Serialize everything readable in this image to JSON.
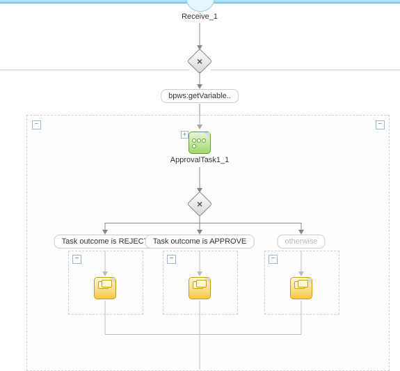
{
  "start": {
    "label": "Receive_1"
  },
  "gateway1": {
    "symbol": "×"
  },
  "condition1": {
    "label": "bpws:getVariable.."
  },
  "outerContainer": {
    "collapseLeft": "−",
    "collapseRight": "−"
  },
  "approvalTask": {
    "label": "ApprovalTask1_1",
    "expand": "+"
  },
  "gateway2": {
    "symbol": "×"
  },
  "branches": [
    {
      "label": "Task outcome is REJECT",
      "collapse": "−",
      "kind": "yellow"
    },
    {
      "label": "Task outcome is APPROVE",
      "collapse": "−",
      "kind": "yellow"
    },
    {
      "label": "otherwise",
      "collapse": "−",
      "kind": "yellow",
      "dim": true
    }
  ]
}
